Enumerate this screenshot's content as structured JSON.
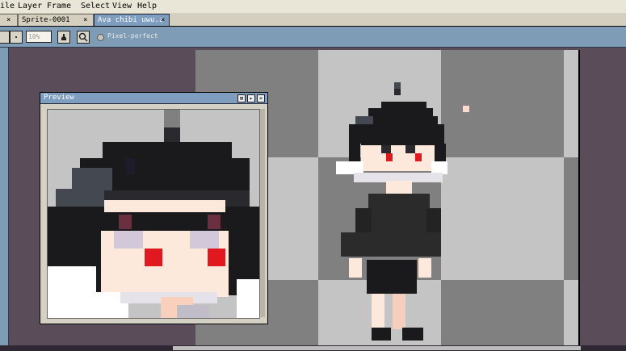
{
  "menu": {
    "items": [
      "ile",
      "Layer",
      "Frame",
      "Select",
      "View",
      "Help"
    ]
  },
  "tabs": [
    {
      "label": "",
      "close": "×",
      "active": false
    },
    {
      "label": "Sprite-0001",
      "close": "×",
      "active": false
    },
    {
      "label": "Ava chibi uwu.z",
      "close": "×",
      "active": true
    }
  ],
  "context_bar": {
    "zoom_value": "10%",
    "pixel_perfect_label": "Pixel-perfect"
  },
  "preview": {
    "title": "Preview",
    "buttons": [
      "⊞",
      "▸",
      "×"
    ]
  },
  "colors": {
    "hair": "#1a1a1d",
    "hair_highlight": "#444851",
    "skin": "#fde9db",
    "eye_red": "#e01820",
    "ruffle_white": "#ffffff",
    "dress": "#2b2b2b",
    "checker_light": "#c4c4c4",
    "checker_dark": "#808080"
  }
}
